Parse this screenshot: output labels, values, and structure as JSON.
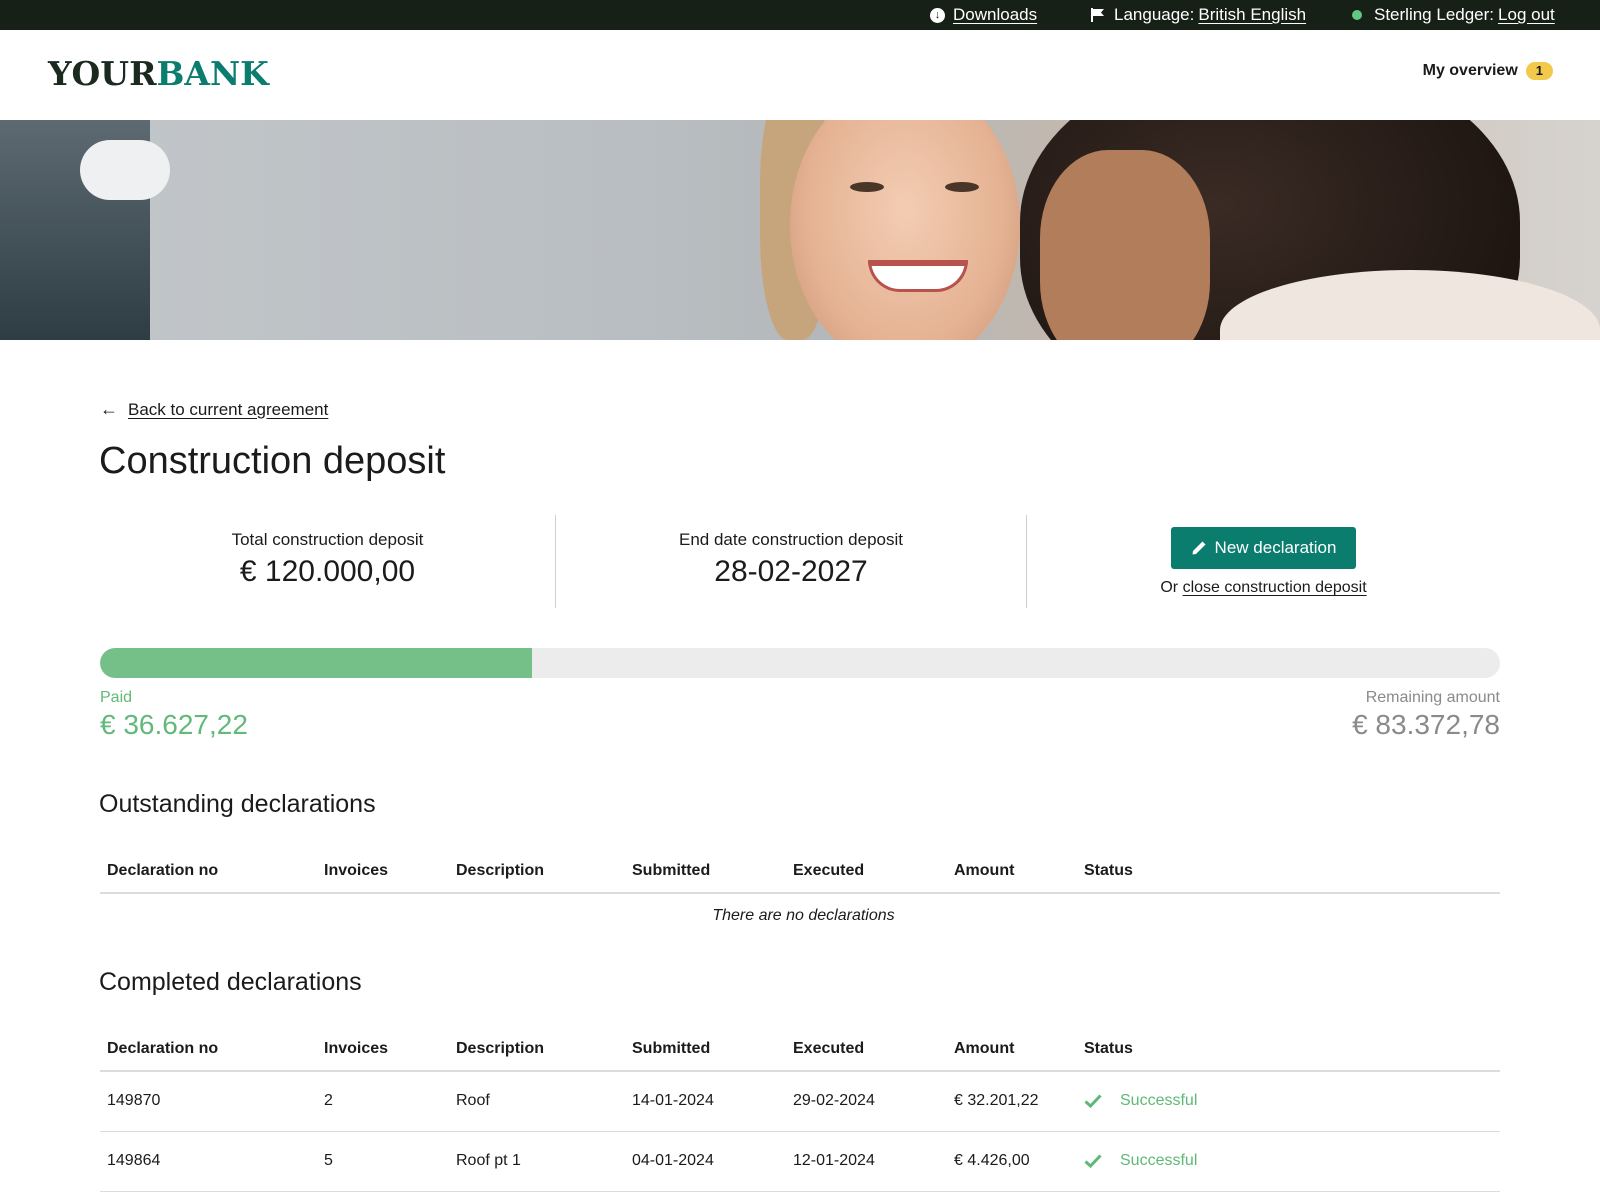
{
  "topbar": {
    "downloads": "Downloads",
    "language_label": "Language:",
    "language_value": "British English",
    "account_name": "Sterling Ledger:",
    "logout": "Log out"
  },
  "header": {
    "logo_part1": "YOUR",
    "logo_part2": "BANK",
    "overview_label": "My overview",
    "overview_count": "1"
  },
  "nav": {
    "back_label": "Back to current agreement"
  },
  "page": {
    "title": "Construction deposit"
  },
  "summary": {
    "total_label": "Total construction deposit",
    "total_value": "€ 120.000,00",
    "end_label": "End date construction deposit",
    "end_value": "28-02-2027",
    "new_button": "New declaration",
    "or_text": "Or",
    "close_link": "close construction deposit"
  },
  "progress": {
    "paid_fraction": 0.3086,
    "paid_label": "Paid",
    "paid_amount": "€ 36.627,22",
    "remaining_label": "Remaining amount",
    "remaining_amount": "€ 83.372,78"
  },
  "outstanding": {
    "title": "Outstanding declarations",
    "columns": [
      "Declaration no",
      "Invoices",
      "Description",
      "Submitted",
      "Executed",
      "Amount",
      "Status"
    ],
    "empty_text": "There are no declarations"
  },
  "completed": {
    "title": "Completed declarations",
    "columns": [
      "Declaration no",
      "Invoices",
      "Description",
      "Submitted",
      "Executed",
      "Amount",
      "Status"
    ],
    "rows": [
      {
        "no": "149870",
        "invoices": "2",
        "description": "Roof",
        "submitted": "14-01-2024",
        "executed": "29-02-2024",
        "amount": "€ 32.201,22",
        "status": "Successful"
      },
      {
        "no": "149864",
        "invoices": "5",
        "description": "Roof pt 1",
        "submitted": "04-01-2024",
        "executed": "12-01-2024",
        "amount": "€ 4.426,00",
        "status": "Successful"
      }
    ]
  },
  "colors": {
    "brand_green": "#0b7d6f",
    "topbar_bg": "#172017",
    "success_green": "#5fb876",
    "progress_fill": "#74c088",
    "badge_yellow": "#f3c94b"
  },
  "icons": {
    "downloads": "download-circle-icon",
    "language": "flag-icon",
    "account_status": "status-dot-icon",
    "back": "arrow-left-icon",
    "new_declaration": "pencil-icon",
    "status_success": "check-icon"
  }
}
